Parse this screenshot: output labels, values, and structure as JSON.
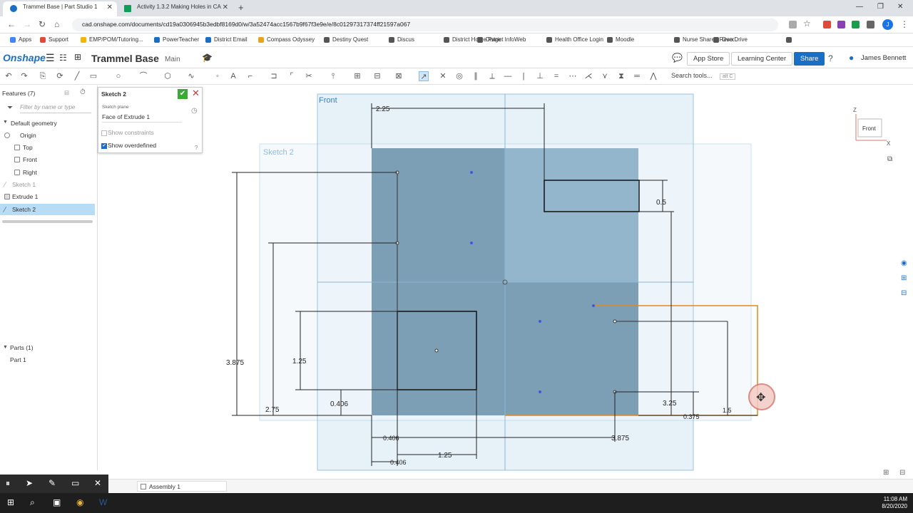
{
  "browser": {
    "tabs": [
      {
        "title": "Trammel Base | Part Studio 1",
        "active": true
      },
      {
        "title": "Activity 1.3.2 Making Holes in CA",
        "active": false
      }
    ],
    "url": "cad.onshape.com/documents/cd19a0306945b3edbf8169d0/w/3a52474acc1567b9f67f3e9e/e/8c01297317374ff21597a067",
    "bookmarks": [
      "Apps",
      "Support",
      "EMP/POM/Tutoring...",
      "PowerTeacher",
      "District Email",
      "Compass Odyssey",
      "Destiny Quest",
      "Discus",
      "District Home Page",
      "District InfoWeb",
      "Health Office Login",
      "Moodle",
      "Nurse Shared Reso...",
      "OverDrive"
    ],
    "profile_initial": "J"
  },
  "onshape": {
    "logo": "Onshape",
    "doc_title": "Trammel Base",
    "workspace": "Main",
    "app_store": "App Store",
    "learning_center": "Learning Center",
    "share": "Share",
    "user": "James Bennett",
    "search_tools": "Search tools...",
    "search_shortcut": "alt C"
  },
  "features": {
    "header": "Features (7)",
    "filter_placeholder": "Filter by name or type",
    "default_geometry": "Default geometry",
    "items": [
      "Origin",
      "Top",
      "Front",
      "Right",
      "Sketch 1",
      "Extrude 1",
      "Sketch 2"
    ],
    "parts_header": "Parts (1)",
    "parts": [
      "Part 1"
    ]
  },
  "sketch_dialog": {
    "title": "Sketch 2",
    "plane_label": "Sketch plane",
    "plane_value": "Face of Extrude 1",
    "show_constraints": "Show constraints",
    "show_overdefined": "Show overdefined"
  },
  "canvas": {
    "front_label": "Front",
    "sketch_label": "Sketch 2",
    "nav_cube_face": "Front",
    "nav_axis_z": "Z",
    "nav_axis_x": "X",
    "dims": {
      "d_2_25": "2.25",
      "d_0_5": "0.5",
      "d_3_875_left": "3.875",
      "d_1_25_v": "1.25",
      "d_0_406_a": "0.406",
      "d_2_75": "2.75",
      "d_3_25": "3.25",
      "d_0_375": "0.375",
      "d_1_5": "1.5",
      "d_0_406_b": "0.406",
      "d_3_875_bottom": "3.875",
      "d_1_25_h": "1.25",
      "d_0_406_c": "0.406"
    }
  },
  "bottom": {
    "assembly_tab": "Assembly 1"
  },
  "taskbar": {
    "time": "11:08 AM",
    "date": "8/20/2020"
  },
  "colors": {
    "onshape_blue": "#1a6fc4",
    "part_fill": "#7d9fb6",
    "sketch_orange": "#e08a1e",
    "selected_feature": "#b7dcf5"
  }
}
